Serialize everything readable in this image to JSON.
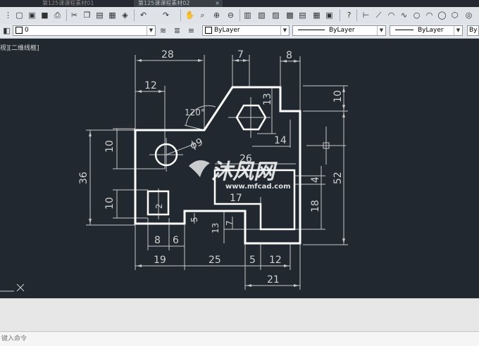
{
  "tabs": [
    {
      "label": "第125课课程素材01"
    },
    {
      "label": "第125课课程素材02"
    }
  ],
  "toolbar_icons": [
    "cut-icon",
    "copy-icon",
    "paste-icon",
    "match-properties-icon",
    "undo-icon",
    "redo-icon",
    "pan-icon",
    "zoom-icon",
    "properties-icon",
    "design-center-icon",
    "help-icon",
    "line-icon",
    "arc-icon",
    "circle-icon"
  ],
  "properties_bar": {
    "layer": "0",
    "color": "ByLayer",
    "linetype": "ByLayer",
    "lineweight": "ByLayer",
    "plot_style": "By"
  },
  "viewport": {
    "label": "视][二维线框]"
  },
  "drawing": {
    "dimensions": {
      "d28": "28",
      "d7": "7",
      "d8": "8",
      "d12": "12",
      "d120": "120°",
      "d13": "13",
      "d10top": "10",
      "d10left": "10",
      "phi9": "ϕ9",
      "d26": "26",
      "d14": "14",
      "d36": "36",
      "d4": "4",
      "d52": "52",
      "d17": "17",
      "d10lower": "10",
      "d2": "2",
      "d18": "18",
      "d5": "5",
      "d7lower": "7",
      "d13lower": "13",
      "d8bottom": "8",
      "d6": "6",
      "d19": "19",
      "d25": "25",
      "d5bottom": "5",
      "d12bottom": "12",
      "d21": "21"
    },
    "watermark": {
      "brand_cn": "沐风网",
      "site": "www.mfcad.com"
    }
  },
  "command": {
    "placeholder": "键入命令"
  },
  "colors": {
    "background": "#212830",
    "geometry": "#ffffff",
    "dimension": "#c8c8c8",
    "watermark": "#ffffff"
  }
}
